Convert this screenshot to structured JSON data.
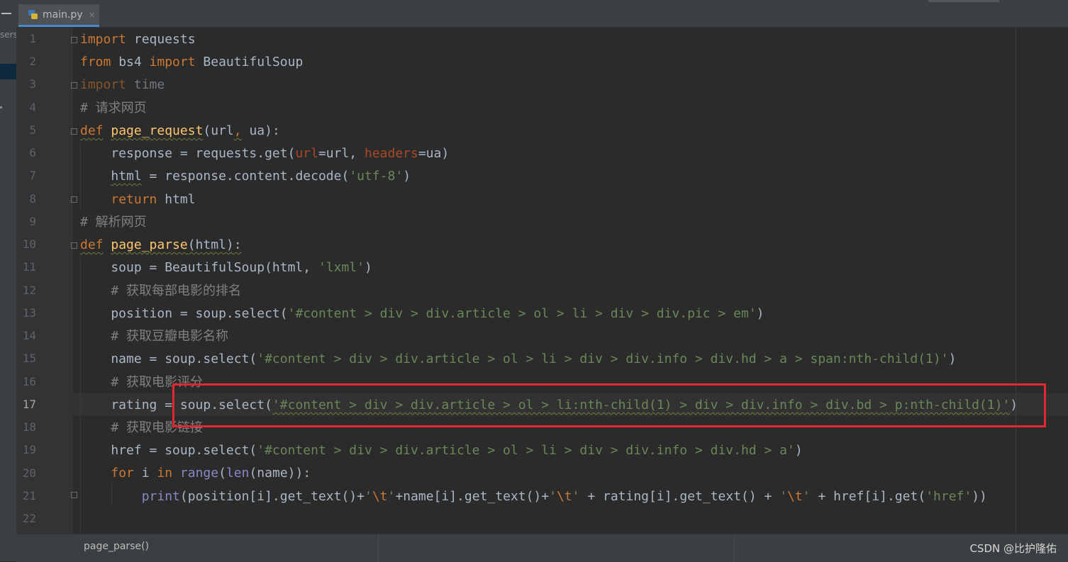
{
  "editor": {
    "tab_label": "main.py",
    "tab_close": "×",
    "left_clip_text": "sers",
    "breadcrumb": "page_parse()",
    "watermark": "CSDN @比护隆佑",
    "line_numbers": [
      "1",
      "2",
      "3",
      "4",
      "5",
      "6",
      "7",
      "8",
      "9",
      "10",
      "11",
      "12",
      "13",
      "14",
      "15",
      "16",
      "17",
      "18",
      "19",
      "20",
      "21",
      "22"
    ],
    "current_line": "17"
  },
  "code": {
    "l1": {
      "t0": "import",
      "t1": " requests"
    },
    "l2": {
      "t0": "from",
      "t1": " bs4 ",
      "t2": "import",
      "t3": " BeautifulSoup"
    },
    "l3": {
      "t0": "import",
      "t1": " time"
    },
    "l4": {
      "t0": "# 请求网页"
    },
    "l5": {
      "t0": "def",
      "t1": " ",
      "t2": "page_request",
      "t3": "(url",
      "t4": ",",
      "t5": " ua):"
    },
    "l6": {
      "t0": "    response = requests.get(",
      "t1": "url",
      "t2": "=url, ",
      "t3": "headers",
      "t4": "=ua)"
    },
    "l7": {
      "t0": "    ",
      "t1": "html",
      "t2": " = response.content.decode(",
      "t3": "'utf-8'",
      "t4": ")"
    },
    "l8": {
      "t0": "    ",
      "t1": "return",
      "t2": " html"
    },
    "l9": {
      "t0": "# 解析网页"
    },
    "l10": {
      "t0": "def",
      "t1": " ",
      "t2": "page_parse",
      "t3": "(html):"
    },
    "l11": {
      "t0": "    soup = BeautifulSoup(html, ",
      "t1": "'lxml'",
      "t2": ")"
    },
    "l12": {
      "t0": "    # 获取每部电影的排名"
    },
    "l13": {
      "t0": "    position = soup.select(",
      "t1": "'#content > div > div.article > ol > li > div > div.pic > em'",
      "t2": ")"
    },
    "l14": {
      "t0": "    # 获取豆瓣电影名称"
    },
    "l15": {
      "t0": "    name = soup.select(",
      "t1": "'#content > div > div.article > ol > li > div > div.info > div.hd > a > span:nth-child(1)'",
      "t2": ")"
    },
    "l16": {
      "t0": "    # 获取电影评分"
    },
    "l17": {
      "t0": "    rating = soup.select(",
      "t1": "'#content > div > div.article > ol > li:nth-child(1) > div > div.info > div.bd > p:nth-child(1)'",
      "t2": ")"
    },
    "l18": {
      "t0": "    # 获取电影链接"
    },
    "l19": {
      "t0": "    href = soup.select(",
      "t1": "'#content > div > div.article > ol > li > div > div.info > div.hd > a'",
      "t2": ")"
    },
    "l20": {
      "t0": "    ",
      "t1": "for",
      "t2": " i ",
      "t3": "in",
      "t4": " ",
      "t5": "range",
      "t6": "(",
      "t7": "len",
      "t8": "(name)):"
    },
    "l21": {
      "t0": "        ",
      "t1": "print",
      "t2": "(position[i].get_text()+",
      "t3": "'",
      "t4": "\\t",
      "t5": "'",
      "t6": "+name[i].get_text()+",
      "t7": "'",
      "t8": "\\t",
      "t9": "'",
      "t10": " + rating[i].get_text() + ",
      "t11": "'",
      "t12": "\\t",
      "t13": "'",
      "t14": " + href[i].get(",
      "t15": "'href'",
      "t16": "))"
    },
    "l22": {
      "t0": ""
    }
  }
}
